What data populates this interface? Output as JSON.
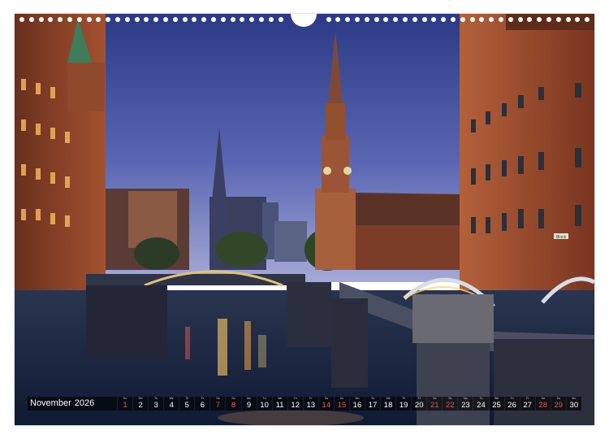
{
  "calendar": {
    "month": "November",
    "year": "2026",
    "days": [
      {
        "n": "1",
        "wd": "Su",
        "red": true
      },
      {
        "n": "2",
        "wd": "Mo",
        "red": false
      },
      {
        "n": "3",
        "wd": "Tu",
        "red": false
      },
      {
        "n": "4",
        "wd": "We",
        "red": false
      },
      {
        "n": "5",
        "wd": "Th",
        "red": false
      },
      {
        "n": "6",
        "wd": "Fr",
        "red": false
      },
      {
        "n": "7",
        "wd": "Sa",
        "red": true
      },
      {
        "n": "8",
        "wd": "Su",
        "red": true
      },
      {
        "n": "9",
        "wd": "Mo",
        "red": false
      },
      {
        "n": "10",
        "wd": "Tu",
        "red": false
      },
      {
        "n": "11",
        "wd": "We",
        "red": false
      },
      {
        "n": "12",
        "wd": "Th",
        "red": false
      },
      {
        "n": "13",
        "wd": "Fr",
        "red": false
      },
      {
        "n": "14",
        "wd": "Sa",
        "red": true
      },
      {
        "n": "15",
        "wd": "Su",
        "red": true
      },
      {
        "n": "16",
        "wd": "Mo",
        "red": false
      },
      {
        "n": "17",
        "wd": "Tu",
        "red": false
      },
      {
        "n": "18",
        "wd": "We",
        "red": false
      },
      {
        "n": "19",
        "wd": "Th",
        "red": false
      },
      {
        "n": "20",
        "wd": "Fr",
        "red": false
      },
      {
        "n": "21",
        "wd": "Sa",
        "red": true
      },
      {
        "n": "22",
        "wd": "Su",
        "red": true
      },
      {
        "n": "23",
        "wd": "Mo",
        "red": false
      },
      {
        "n": "24",
        "wd": "Tu",
        "red": false
      },
      {
        "n": "25",
        "wd": "We",
        "red": false
      },
      {
        "n": "26",
        "wd": "Th",
        "red": false
      },
      {
        "n": "27",
        "wd": "Fr",
        "red": false
      },
      {
        "n": "28",
        "wd": "Sa",
        "red": true
      },
      {
        "n": "29",
        "wd": "Su",
        "red": true
      },
      {
        "n": "30",
        "wd": "Mo",
        "red": false
      }
    ]
  },
  "photo": {
    "sign_text": "Block"
  },
  "colors": {
    "sky_top": "#2f3d8a",
    "sky_bottom": "#8a94cf",
    "brick": "#8a3e26",
    "water": "#1b2a4a",
    "lights": "#ffcf6a",
    "weekend": "#e05a4a"
  }
}
